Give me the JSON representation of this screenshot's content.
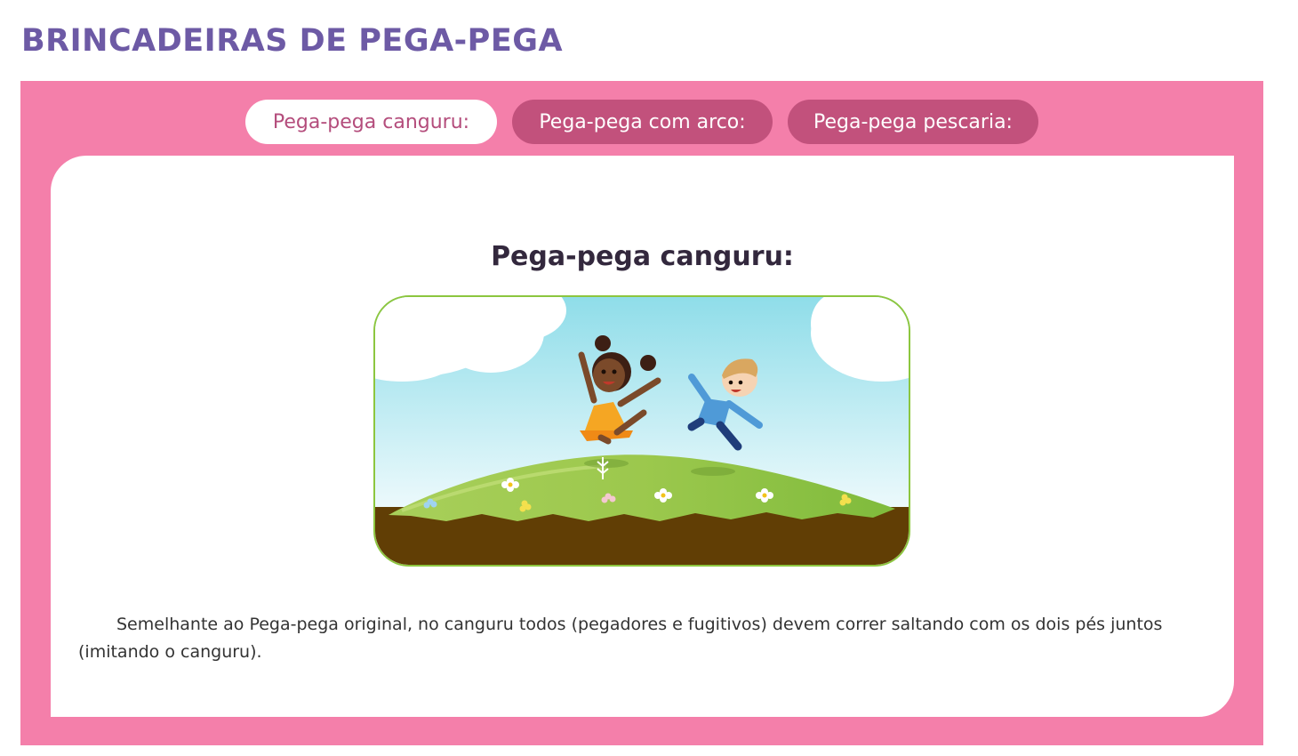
{
  "page": {
    "title": "BRINCADEIRAS DE PEGA-PEGA"
  },
  "tabs": [
    {
      "label": "Pega-pega canguru:",
      "active": true
    },
    {
      "label": "Pega-pega com arco:",
      "active": false
    },
    {
      "label": "Pega-pega pescaria:",
      "active": false
    }
  ],
  "content": {
    "heading": "Pega-pega canguru:",
    "description": "Semelhante ao Pega-pega original, no canguru todos (pegadores e fugitivos) devem correr saltando com os dois pés juntos (imitando o canguru)."
  },
  "colors": {
    "title": "#6d5aa5",
    "frame": "#f47faa",
    "tab_active_bg": "#ffffff",
    "tab_active_text": "#b44d7c",
    "tab_inactive_bg": "#c2517c",
    "image_border": "#8cc63f"
  }
}
